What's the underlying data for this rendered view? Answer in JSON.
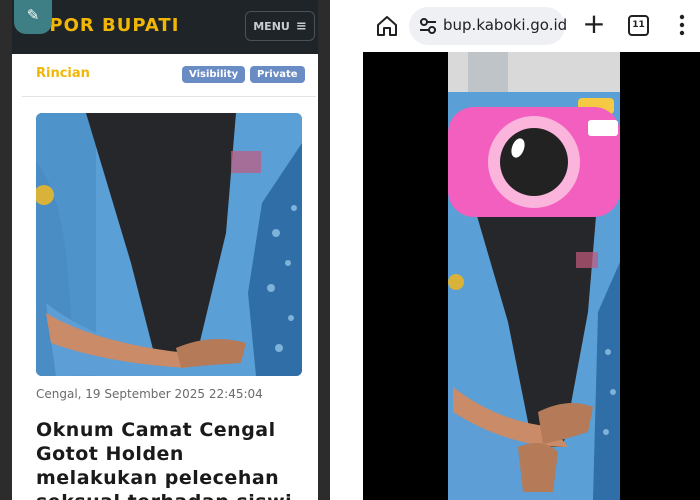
{
  "left": {
    "brand": "LAPOR BUPATI",
    "menu_label": "MENU",
    "card_title": "Rincian",
    "badges": [
      "Visibility",
      "Private"
    ],
    "date": "Cengal, 19 September 2025 22:45:04",
    "headline": "Oknum Camat Cengal Gotot Holden melakukan pelecehan seksual terhadap siswi"
  },
  "right": {
    "url": "bup.kaboki.go.id",
    "tab_count": "11"
  },
  "colors": {
    "navbar": "#1f2429",
    "brand_yellow": "#f2b705",
    "badge_blue": "#6a8cc4",
    "shirt_blue": "#5a9fd6",
    "camera_pink": "#f25fbf"
  }
}
